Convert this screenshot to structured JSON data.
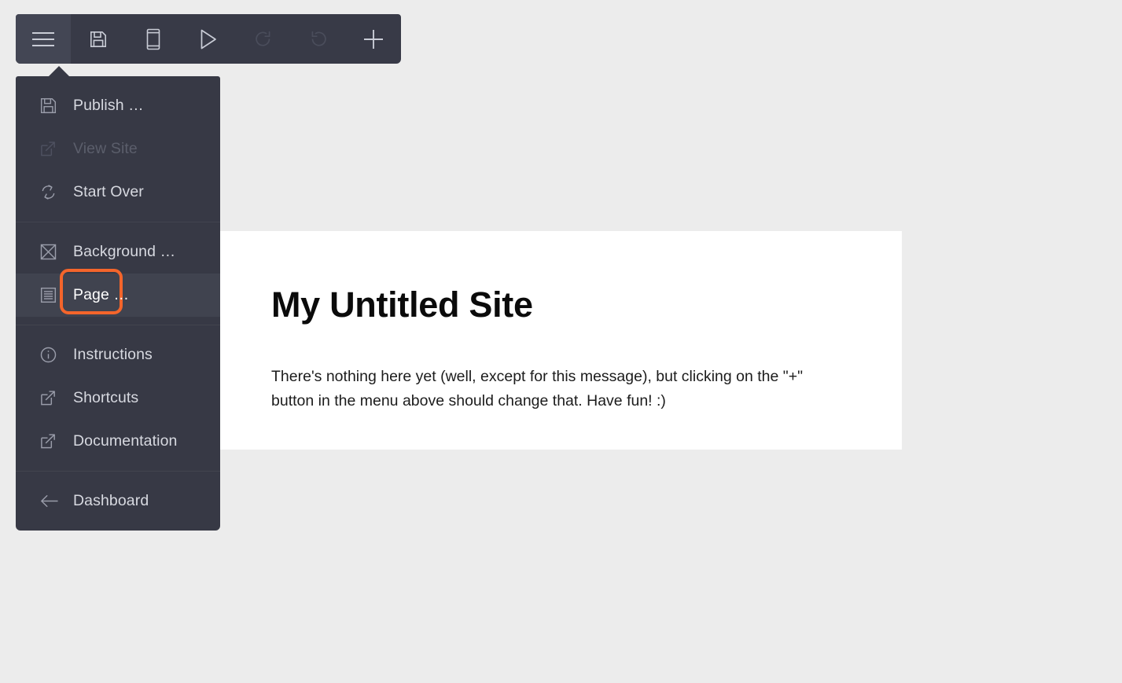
{
  "toolbar": {
    "buttons": [
      {
        "name": "menu-toggle",
        "icon": "hamburger-icon",
        "label": "Menu",
        "state": "active"
      },
      {
        "name": "save",
        "icon": "floppy-disk-icon",
        "label": "Save",
        "state": "enabled"
      },
      {
        "name": "mobile-preview",
        "icon": "mobile-device-icon",
        "label": "Mobile Preview",
        "state": "enabled"
      },
      {
        "name": "preview",
        "icon": "play-triangle-icon",
        "label": "Preview",
        "state": "enabled"
      },
      {
        "name": "redo",
        "icon": "redo-arrow-icon",
        "label": "Redo",
        "state": "disabled"
      },
      {
        "name": "undo",
        "icon": "undo-arrow-icon",
        "label": "Undo",
        "state": "disabled"
      },
      {
        "name": "add",
        "icon": "plus-icon",
        "label": "Add",
        "state": "enabled"
      }
    ]
  },
  "menu": {
    "groups": [
      {
        "items": [
          {
            "label": "Publish …",
            "icon": "floppy-disk-icon",
            "state": "enabled"
          },
          {
            "label": "View Site",
            "icon": "external-link-icon",
            "state": "disabled"
          },
          {
            "label": "Start Over",
            "icon": "refresh-cycle-icon",
            "state": "enabled"
          }
        ]
      },
      {
        "items": [
          {
            "label": "Background …",
            "icon": "image-placeholder-icon",
            "state": "enabled"
          },
          {
            "label": "Page …",
            "icon": "document-lines-icon",
            "state": "focused"
          }
        ]
      },
      {
        "items": [
          {
            "label": "Instructions",
            "icon": "info-circle-icon",
            "state": "enabled"
          },
          {
            "label": "Shortcuts",
            "icon": "external-link-icon",
            "state": "enabled"
          },
          {
            "label": "Documentation",
            "icon": "external-link-icon",
            "state": "enabled"
          }
        ]
      },
      {
        "items": [
          {
            "label": "Dashboard",
            "icon": "arrow-left-icon",
            "state": "enabled"
          }
        ]
      }
    ]
  },
  "content": {
    "title": "My Untitled Site",
    "body": "There's nothing here yet (well, except for this message), but clicking on the \"+\" button in the menu above should change that. Have fun! :)"
  },
  "colors": {
    "panel_background": "#373945",
    "toolbar_background": "#383a47",
    "row_hover": "#40434f",
    "focus_ring": "#f4652b",
    "page_background": "#ececec",
    "card_background": "#ffffff",
    "label_text": "#d7d9e0",
    "disabled_text": "#5b5e6b"
  }
}
